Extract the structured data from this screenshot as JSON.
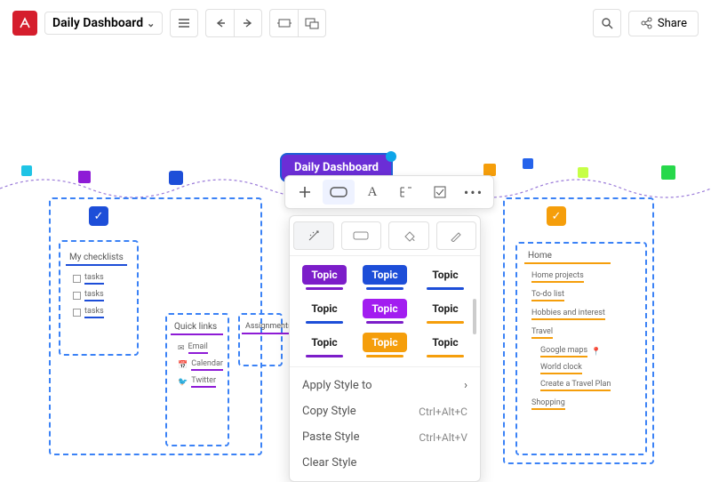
{
  "header": {
    "title": "Daily Dashboard",
    "share": "Share"
  },
  "root_badge": "Daily Dashboard",
  "panel": {
    "swatches": [
      "Topic",
      "Topic",
      "Topic",
      "Topic",
      "Topic",
      "Topic",
      "Topic",
      "Topic",
      "Topic"
    ],
    "menu": {
      "apply": "Apply Style to",
      "copy": "Copy Style",
      "copy_sc": "Ctrl+Alt+C",
      "paste": "Paste Style",
      "paste_sc": "Ctrl+Alt+V",
      "clear": "Clear Style"
    }
  },
  "groups": {
    "checklists": {
      "title": "My checklists",
      "items": [
        "tasks",
        "tasks",
        "tasks"
      ]
    },
    "quicklinks": {
      "title": "Quick links",
      "items": [
        "Email",
        "Calendar",
        "Twitter"
      ]
    },
    "assignments": {
      "title": "Assignments"
    },
    "home": {
      "title": "Home",
      "items": [
        "Home projects",
        "To-do list",
        "Hobbies and interest",
        "Travel"
      ],
      "sub": [
        "Google maps",
        "World clock",
        "Create a Travel  Plan"
      ],
      "tail": "Shopping"
    }
  }
}
